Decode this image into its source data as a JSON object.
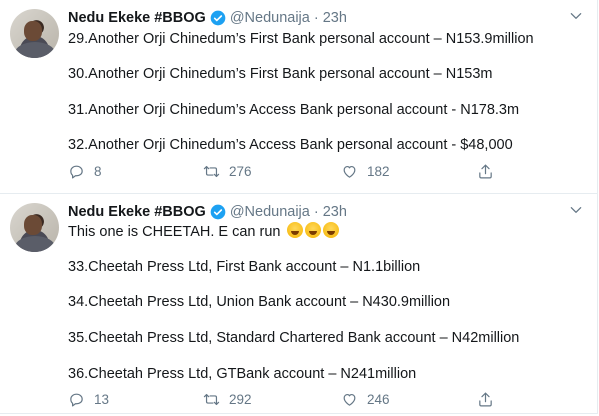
{
  "tweets": [
    {
      "author_name": "Nedu Ekeke #BBOG",
      "handle": "@Nedunaija",
      "separator": "·",
      "time": "23h",
      "lines": [
        "29.Another Orji Chinedum’s First Bank personal account – N153.9million",
        "30.Another Orji Chinedum’s First Bank personal account – N153m",
        "31.Another Orji Chinedum’s Access Bank personal account - N178.3m",
        "32.Another Orji Chinedum’s Access Bank personal account - $48,000"
      ],
      "replies": "8",
      "retweets": "276",
      "likes": "182"
    },
    {
      "author_name": "Nedu Ekeke #BBOG",
      "handle": "@Nedunaija",
      "separator": "·",
      "time": "23h",
      "intro": "This one is CHEETAH. E can run",
      "intro_emoji": [
        "face-with-tears-of-joy",
        "face-with-tears-of-joy",
        "face-with-tears-of-joy"
      ],
      "lines": [
        "33.Cheetah Press Ltd, First Bank account – N1.1billion",
        "34.Cheetah Press Ltd, Union Bank account – N430.9million",
        "35.Cheetah Press Ltd, Standard Chartered Bank account – N42million",
        "36.Cheetah Press Ltd, GTBank account – N241million"
      ],
      "replies": "13",
      "retweets": "292",
      "likes": "246"
    }
  ],
  "colors": {
    "text": "#14171a",
    "muted": "#657786",
    "verified": "#1da1f2",
    "border": "#e6ecf0"
  }
}
